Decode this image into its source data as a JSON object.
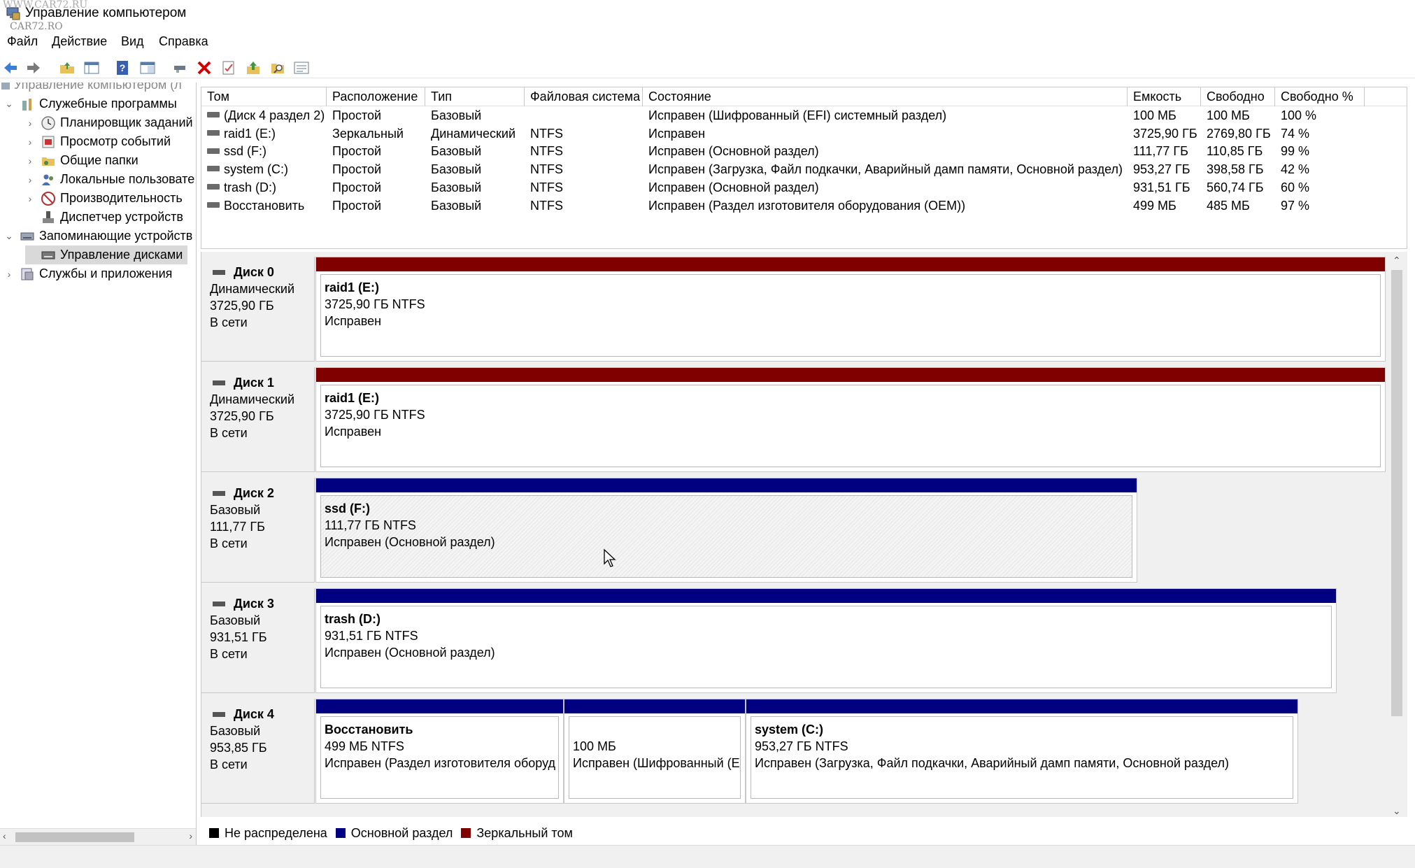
{
  "window": {
    "title": "Управление компьютером",
    "watermark_1": "WWW.CAR72.RU",
    "watermark_2": "CAR72.RO"
  },
  "menu": [
    "Файл",
    "Действие",
    "Вид",
    "Справка"
  ],
  "toolbar": {
    "icons": [
      "back-arrow-icon",
      "forward-arrow-icon",
      "up-folder-icon",
      "console-tree-icon",
      "help-icon",
      "show-hide-pane-icon",
      "connect-icon",
      "delete-icon",
      "properties-icon",
      "import-icon",
      "search-icon",
      "settings-list-icon"
    ]
  },
  "tree": {
    "root_label": "Управление компьютером (л",
    "items": [
      {
        "label": "Служебные программы",
        "expander": "⌄",
        "icon": "tools-icon"
      },
      {
        "label": "Планировщик заданий",
        "expander": "›",
        "icon": "clock-icon"
      },
      {
        "label": "Просмотр событий",
        "expander": "›",
        "icon": "event-viewer-icon"
      },
      {
        "label": "Общие папки",
        "expander": "›",
        "icon": "shared-folder-icon"
      },
      {
        "label": "Локальные пользовате",
        "expander": "›",
        "icon": "users-icon"
      },
      {
        "label": "Производительность",
        "expander": "›",
        "icon": "performance-icon"
      },
      {
        "label": "Диспетчер устройств",
        "expander": "",
        "icon": "device-manager-icon"
      },
      {
        "label": "Запоминающие устройств",
        "expander": "⌄",
        "icon": "storage-icon"
      },
      {
        "label": "Управление дисками",
        "expander": "",
        "icon": "disk-management-icon"
      },
      {
        "label": "Службы и приложения",
        "expander": "›",
        "icon": "services-icon"
      }
    ]
  },
  "volumes": {
    "columns": [
      "Том",
      "Расположение",
      "Тип",
      "Файловая система",
      "Состояние",
      "Емкость",
      "Свободно",
      "Свободно %"
    ],
    "rows": [
      [
        "(Диск 4 раздел 2)",
        "Простой",
        "Базовый",
        "",
        "Исправен (Шифрованный (EFI) системный раздел)",
        "100 МБ",
        "100 МБ",
        "100 %"
      ],
      [
        "raid1 (E:)",
        "Зеркальный",
        "Динамический",
        "NTFS",
        "Исправен",
        "3725,90 ГБ",
        "2769,80 ГБ",
        "74 %"
      ],
      [
        "ssd (F:)",
        "Простой",
        "Базовый",
        "NTFS",
        "Исправен (Основной раздел)",
        "111,77 ГБ",
        "110,85 ГБ",
        "99 %"
      ],
      [
        "system (C:)",
        "Простой",
        "Базовый",
        "NTFS",
        "Исправен (Загрузка, Файл подкачки, Аварийный дамп памяти, Основной раздел)",
        "953,27 ГБ",
        "398,58 ГБ",
        "42 %"
      ],
      [
        "trash (D:)",
        "Простой",
        "Базовый",
        "NTFS",
        "Исправен (Основной раздел)",
        "931,51 ГБ",
        "560,74 ГБ",
        "60 %"
      ],
      [
        "Восстановить",
        "Простой",
        "Базовый",
        "NTFS",
        "Исправен (Раздел изготовителя оборудования (OEM))",
        "499 МБ",
        "485 МБ",
        "97 %"
      ]
    ]
  },
  "disks": [
    {
      "name": "Диск 0",
      "type": "Динамический",
      "size": "3725,90 ГБ",
      "status": "В сети",
      "partitions": [
        {
          "name": "raid1  (E:)",
          "size_fs": "3725,90 ГБ NTFS",
          "state": "Исправен",
          "color": "#800000",
          "hatched": false
        }
      ]
    },
    {
      "name": "Диск 1",
      "type": "Динамический",
      "size": "3725,90 ГБ",
      "status": "В сети",
      "partitions": [
        {
          "name": "raid1  (E:)",
          "size_fs": "3725,90 ГБ NTFS",
          "state": "Исправен",
          "color": "#800000",
          "hatched": false
        }
      ]
    },
    {
      "name": "Диск 2",
      "type": "Базовый",
      "size": "111,77 ГБ",
      "status": "В сети",
      "partitions": [
        {
          "name": "ssd  (F:)",
          "size_fs": "111,77 ГБ NTFS",
          "state": "Исправен (Основной раздел)",
          "color": "#000080",
          "hatched": true
        }
      ]
    },
    {
      "name": "Диск 3",
      "type": "Базовый",
      "size": "931,51 ГБ",
      "status": "В сети",
      "partitions": [
        {
          "name": "trash  (D:)",
          "size_fs": "931,51 ГБ NTFS",
          "state": "Исправен (Основной раздел)",
          "color": "#000080",
          "hatched": false
        }
      ]
    },
    {
      "name": "Диск 4",
      "type": "Базовый",
      "size": "953,85 ГБ",
      "status": "В сети",
      "partitions": [
        {
          "name": "Восстановить",
          "size_fs": "499 МБ NTFS",
          "state": "Исправен (Раздел изготовителя оборуд",
          "color": "#000080",
          "hatched": false
        },
        {
          "name": "",
          "size_fs": "100 МБ",
          "state": "Исправен (Шифрованный (E",
          "color": "#000080",
          "hatched": false
        },
        {
          "name": "system  (C:)",
          "size_fs": "953,27 ГБ NTFS",
          "state": "Исправен (Загрузка, Файл подкачки, Аварийный дамп памяти, Основной раздел)",
          "color": "#000080",
          "hatched": false
        }
      ]
    }
  ],
  "legend": [
    {
      "label": "Не распределена",
      "color": "#000000"
    },
    {
      "label": "Основной раздел",
      "color": "#000080"
    },
    {
      "label": "Зеркальный том",
      "color": "#800000"
    }
  ]
}
